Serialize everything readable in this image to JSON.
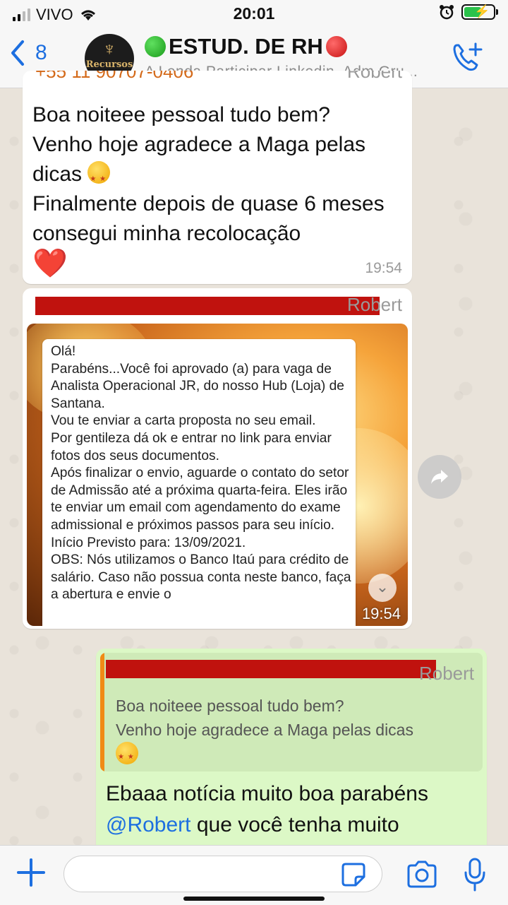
{
  "status_bar": {
    "carrier": "VIVO",
    "time": "20:01",
    "battery_icon": "battery-charging-icon"
  },
  "header": {
    "back_count": "8",
    "group_title": "ESTUD. DE RH",
    "group_subtitle": "A Lenda Participar Linkedin, Adm Gru...",
    "avatar_text": "Recursos Humanos",
    "title_emojis": [
      "green-circle-icon",
      "red-circle-icon"
    ],
    "call_icon": "add-call-icon"
  },
  "messages": [
    {
      "sender_name": "Robert",
      "sender_phone_partial": "+55 11 90707-0406",
      "text_before_emoji": "Boa noiteee pessoal tudo bem?\nVenho hoje agradece a Maga pelas dicas ",
      "text_after_emoji": "\nFinalmente depois de quase 6 meses consegui minha recolocação",
      "emoji_1": "star-struck-emoji",
      "emoji_2": "❤️",
      "time": "19:54"
    },
    {
      "sender_name": "Robert",
      "photo_text": "Olá!\nParabéns...Você foi aprovado (a) para vaga de Analista Operacional JR, do nosso Hub (Loja) de Santana.\nVou te enviar a carta proposta no seu email.\nPor gentileza dá ok e entrar no link para enviar fotos dos seus documentos.\nApós finalizar o envio, aguarde o contato do setor de Admissão até a próxima quarta-feira. Eles irão te enviar um email com agendamento do exame admissional e próximos passos para seu início.\nInício Previsto para: 13/09/2021.\nOBS: Nós utilizamos o Banco Itaú para crédito de salário. Caso não possua conta neste banco, faça a abertura e envie o",
      "time": "19:54"
    },
    {
      "quoted_sender": "Robert",
      "quoted_text": "Boa noiteee pessoal tudo bem?\nVenho hoje agradece a Maga pelas dicas",
      "quoted_emoji": "star-struck-emoji",
      "reply_before": "Ebaaa notícia muito boa parabéns ",
      "mention": "@Robert",
      "reply_after": " que você tenha muito"
    }
  ],
  "input_bar": {
    "placeholder": ""
  },
  "colors": {
    "accent": "#1d6fe0",
    "outgoing_bubble": "#dcf8c6",
    "quote_bar": "#f08a16",
    "redaction": "#c0120e"
  }
}
